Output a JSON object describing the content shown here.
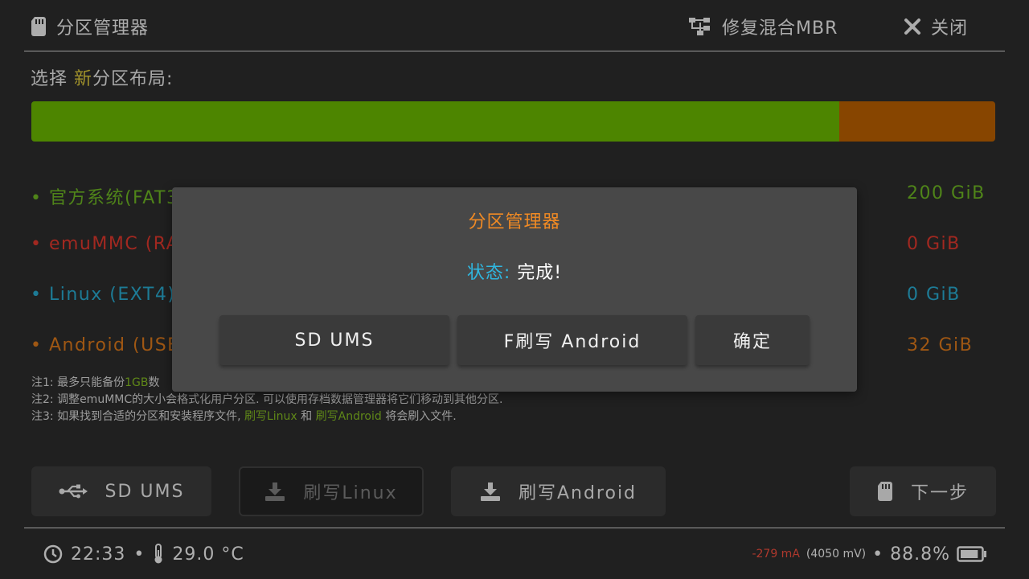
{
  "header": {
    "title": "分区管理器",
    "title_icon": "sd-card-icon",
    "fix_mbr_label": "修复混合MBR",
    "fix_mbr_icon": "hierarchy-icon",
    "close_label": "关闭",
    "close_icon": "close-icon"
  },
  "layout": {
    "prefix": "选择 ",
    "highlight": "新",
    "suffix": "分区布局:"
  },
  "partition_bar": [
    {
      "label": "官方系统",
      "fraction": 0.838,
      "color": "#67b200"
    },
    {
      "label": "Android",
      "fraction": 0.162,
      "color": "#b45c00"
    }
  ],
  "partitions": [
    {
      "name": "• 官方系统(FAT32)",
      "size": "200 GiB",
      "color": "#6ab022"
    },
    {
      "name": "• emuMMC (RAW)",
      "size": "0 GiB",
      "color": "#d9362b"
    },
    {
      "name": "• Linux (EXT4)",
      "size": "0 GiB",
      "color": "#27a5c9"
    },
    {
      "name": "• Android (USER)",
      "size": "32 GiB",
      "color": "#d5741a"
    }
  ],
  "notes": {
    "n1_a": "注1: 最多只能备份",
    "n1_hl": "1GB",
    "n1_b": "数",
    "n2": "注2: 调整emuMMC的大小会格式化用户分区. 可以使用存档数据管理器将它们移动到其他分区.",
    "n3_a": "注3: 如果找到合适的分区和安装程序文件, ",
    "n3_hl1": "刷写Linux",
    "n3_b": " 和 ",
    "n3_hl2": "刷写Android",
    "n3_c": " 将会刷入文件."
  },
  "buttons": {
    "sd_ums": "SD UMS",
    "flash_linux": "刷写Linux",
    "flash_android": "刷写Android",
    "next": "下一步"
  },
  "footer": {
    "time": "22:33",
    "dot": "•",
    "temperature": "29.0 °C",
    "current": "-279 mA",
    "voltage": "(4050 mV)",
    "battery_dot": "•",
    "battery": "88.8%",
    "battery_level": 0.888
  },
  "modal": {
    "title": "分区管理器",
    "status_key": "状态: ",
    "status_value": "完成!",
    "btn_sd_ums": "SD UMS",
    "btn_flash_android": "F刷写 Android",
    "btn_ok": "确定"
  },
  "colors": {
    "accent_new": "#d7c33a",
    "modal_title": "#f08a24",
    "status_key": "#2fb7e0"
  }
}
